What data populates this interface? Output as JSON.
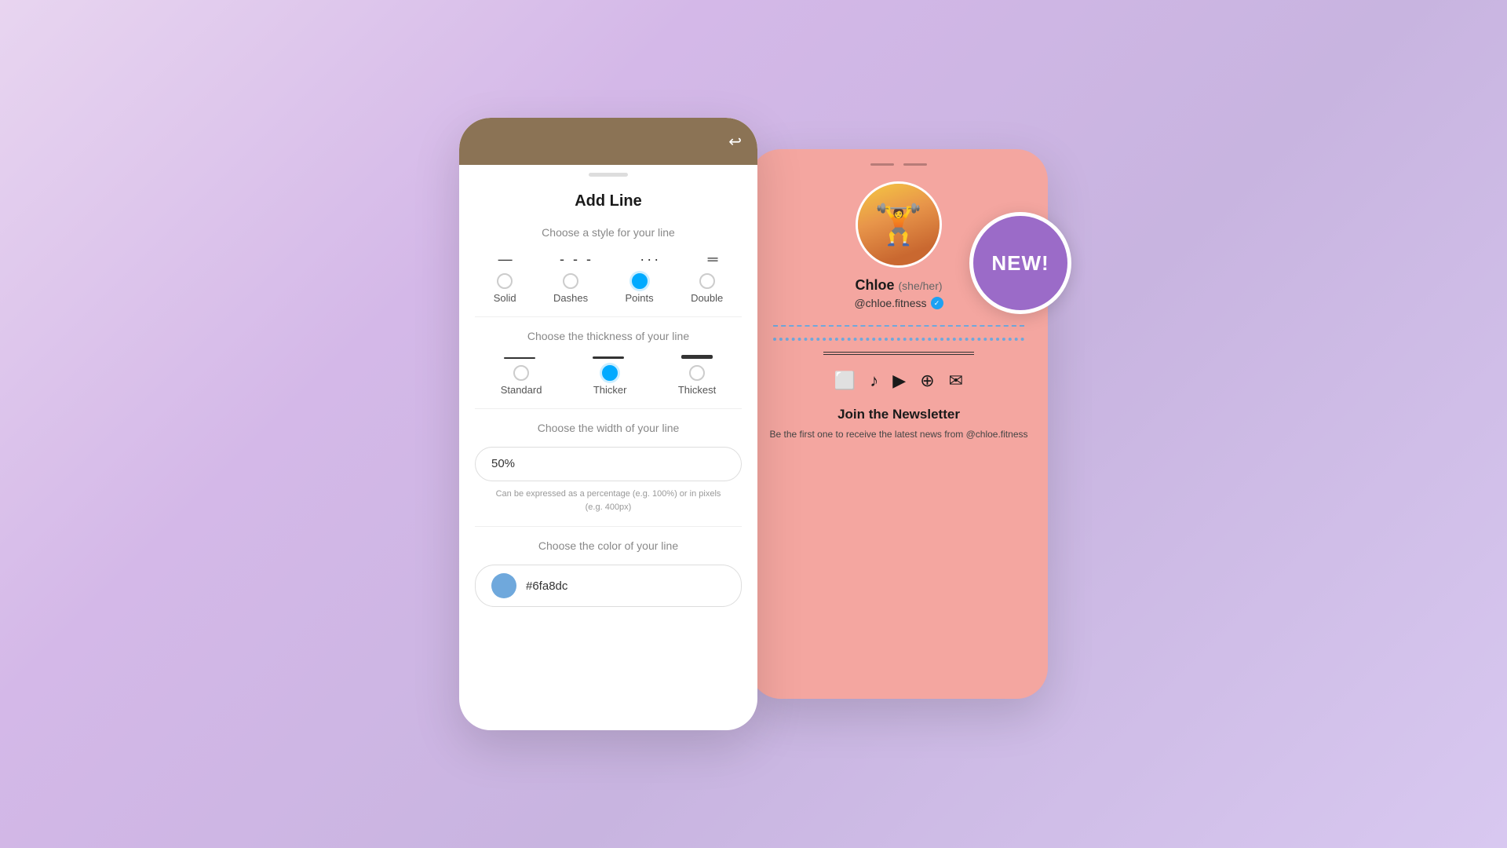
{
  "left_panel": {
    "title": "Add Line",
    "style_section": {
      "label": "Choose a style for your line",
      "options": [
        {
          "id": "solid",
          "label": "Solid",
          "preview": "—",
          "selected": false
        },
        {
          "id": "dashes",
          "label": "Dashes",
          "preview": "- - -",
          "selected": false
        },
        {
          "id": "points",
          "label": "Points",
          "preview": "···",
          "selected": true
        },
        {
          "id": "double",
          "label": "Double",
          "preview": "═",
          "selected": false
        }
      ]
    },
    "thickness_section": {
      "label": "Choose the thickness of your line",
      "options": [
        {
          "id": "standard",
          "label": "Standard",
          "selected": false
        },
        {
          "id": "thicker",
          "label": "Thicker",
          "selected": true
        },
        {
          "id": "thickest",
          "label": "Thickest",
          "selected": false
        }
      ]
    },
    "width_section": {
      "label": "Choose the width of your line",
      "value": "50%",
      "hint": "Can be expressed as a percentage (e.g. 100%) or in pixels\n(e.g. 400px)"
    },
    "color_section": {
      "label": "Choose the color of your line",
      "value": "#6fa8dc",
      "swatch_color": "#6fa8dc"
    }
  },
  "right_panel": {
    "profile": {
      "name": "Chloe",
      "pronouns": "(she/her)",
      "handle": "@chloe.fitness",
      "verified": true
    },
    "newsletter": {
      "title": "Join the Newsletter",
      "text": "Be the first one to receive the latest news from @chloe.fitness"
    },
    "social_icons": [
      "instagram",
      "tiktok",
      "youtube",
      "podcasts",
      "email"
    ]
  },
  "new_badge": {
    "text": "NEW!",
    "bg_color": "#9b6bc8"
  }
}
